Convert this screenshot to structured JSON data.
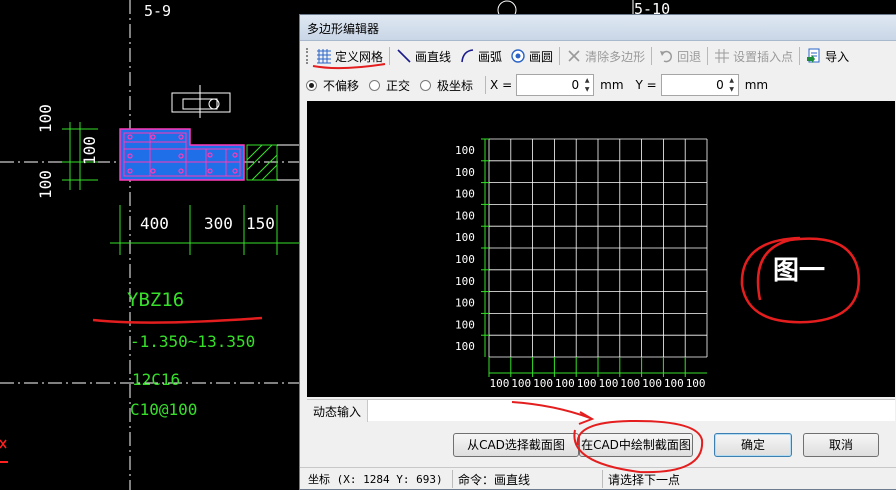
{
  "cad": {
    "axis_top_left": "5-9",
    "axis_top_right": "5-10",
    "dim_vertical_top": "100",
    "dim_vertical_mid": "100",
    "dim_vertical_bottom": "100",
    "dim_h1": "400",
    "dim_h2": "300",
    "dim_h3": "150",
    "column_name": "YBZ16",
    "elevation": "-1.350~13.350",
    "rebar_main": "12C16",
    "rebar_stirrup": "C10@100",
    "colors": {
      "green": "#36e02a",
      "fill_blue": "#1e6fe8",
      "magenta": "#ff3ab8"
    }
  },
  "dialog": {
    "title": "多边形编辑器",
    "toolbar": {
      "define_grid": "定义网格",
      "draw_line": "画直线",
      "draw_arc": "画弧",
      "draw_circle": "画圆",
      "clear_polygon": "清除多边形",
      "undo": "回退",
      "set_insert_point": "设置插入点",
      "import": "导入"
    },
    "options": {
      "no_offset": "不偏移",
      "orthogonal": "正交",
      "polar": "极坐标",
      "x_label": "X =",
      "x_value": "0",
      "x_unit": "mm",
      "y_label": "Y =",
      "y_value": "0",
      "y_unit": "mm"
    },
    "grid": {
      "x_spacings": [
        "100",
        "100",
        "100",
        "100",
        "100",
        "100",
        "100",
        "100",
        "100",
        "100"
      ],
      "y_spacings": [
        "100",
        "100",
        "100",
        "100",
        "100",
        "100",
        "100",
        "100",
        "100",
        "100"
      ]
    },
    "tab_dynamic_input": "动态输入",
    "buttons": {
      "select_from_cad": "从CAD选择截面图",
      "draw_in_cad": "在CAD中绘制截面图",
      "ok": "确定",
      "cancel": "取消"
    },
    "status": {
      "coords": "坐标 (X: 1284 Y: 693)",
      "command": "命令：画直线",
      "prompt": "请选择下一点"
    }
  },
  "annotation": {
    "figure_label": "图一"
  }
}
